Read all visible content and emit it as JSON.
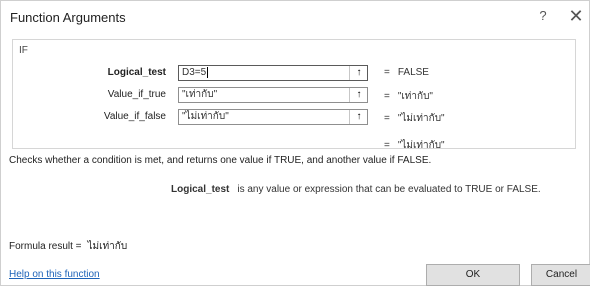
{
  "dialog": {
    "title": "Function Arguments",
    "help_symbol": "?",
    "close_symbol": "✕"
  },
  "function_name": "IF",
  "arguments": [
    {
      "label": "Logical_test",
      "value": "D3=5",
      "result": "FALSE"
    },
    {
      "label": "Value_if_true",
      "value": "\"เท่ากับ\"",
      "result": "\"เท่ากับ\""
    },
    {
      "label": "Value_if_false",
      "value": "\"ไม่เท่ากับ\"",
      "result": "\"ไม่เท่ากับ\""
    }
  ],
  "equals_sign": "=",
  "collapse_icon": "↑",
  "overall_result": "\"ไม่เท่ากับ\"",
  "description": "Checks whether a condition is met, and returns one value if TRUE, and another value if FALSE.",
  "argument_help": {
    "name": "Logical_test",
    "text": "is any value or expression that can be evaluated to TRUE or FALSE."
  },
  "formula_result": {
    "label": "Formula result =",
    "value": "ไม่เท่ากับ"
  },
  "help_link": "Help on this function",
  "buttons": {
    "ok": "OK",
    "cancel": "Cancel"
  }
}
